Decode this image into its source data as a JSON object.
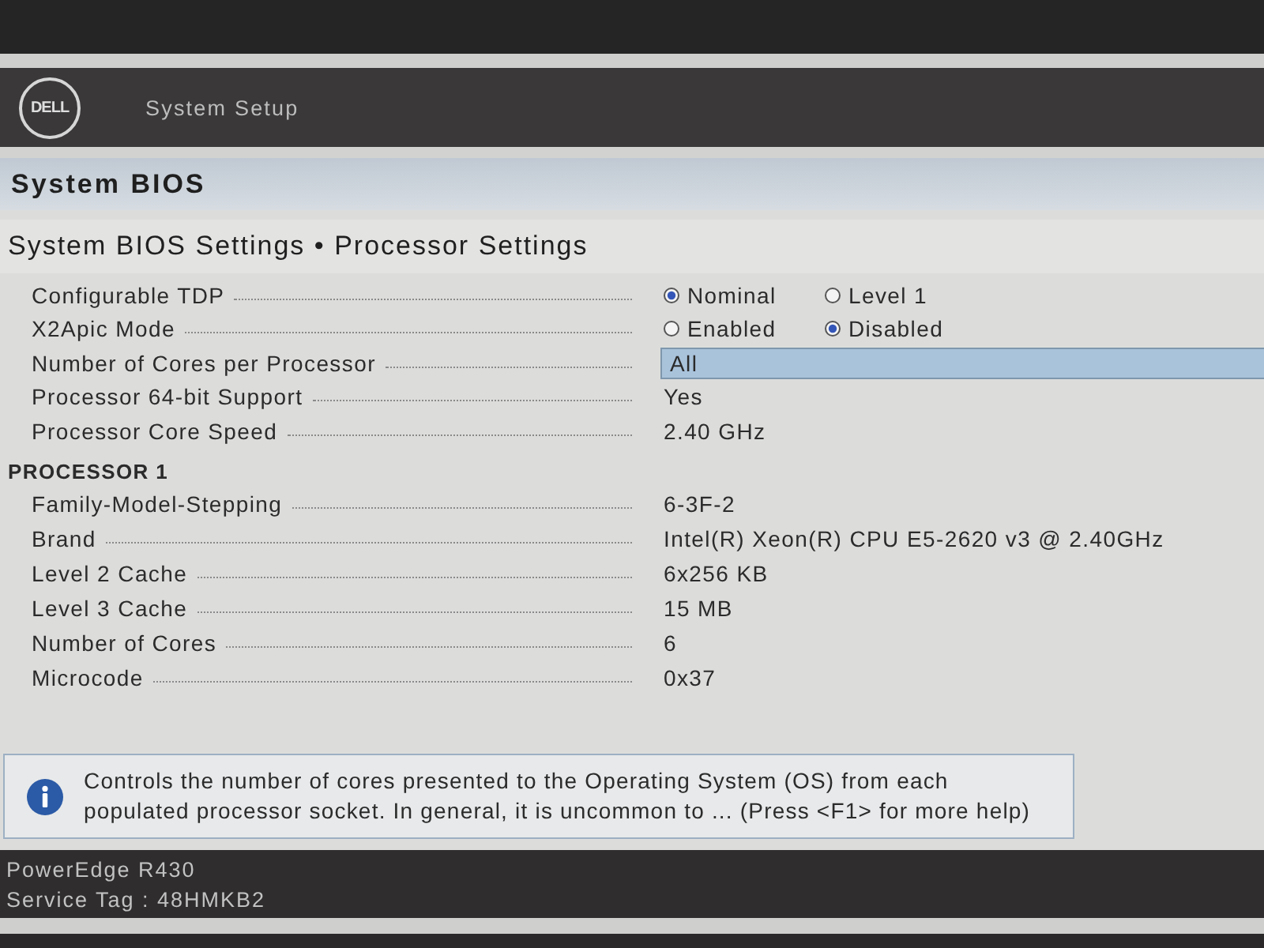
{
  "header": {
    "logo": "DELL",
    "title": "System Setup"
  },
  "section_bar": {
    "title": "System BIOS"
  },
  "page_title": "System BIOS Settings • Processor Settings",
  "settings": [
    {
      "kind": "radio",
      "label": "Configurable TDP",
      "selected": false,
      "options": [
        {
          "label": "Nominal",
          "selected": true
        },
        {
          "label": "Level 1",
          "selected": false
        }
      ]
    },
    {
      "kind": "radio",
      "label": "X2Apic Mode",
      "selected": false,
      "options": [
        {
          "label": "Enabled",
          "selected": false
        },
        {
          "label": "Disabled",
          "selected": true
        }
      ]
    },
    {
      "kind": "dropdown",
      "label": "Number of Cores per Processor",
      "selected": true,
      "value": "All"
    },
    {
      "kind": "text",
      "label": "Processor 64-bit Support",
      "selected": false,
      "value": "Yes"
    },
    {
      "kind": "text",
      "label": "Processor Core Speed",
      "selected": false,
      "value": "2.40 GHz"
    }
  ],
  "processor": {
    "heading": "PROCESSOR 1",
    "rows": [
      {
        "label": "Family-Model-Stepping",
        "value": "6-3F-2"
      },
      {
        "label": "Brand",
        "value": "Intel(R) Xeon(R) CPU E5-2620 v3 @ 2.40GHz"
      },
      {
        "label": "Level 2 Cache",
        "value": "6x256 KB"
      },
      {
        "label": "Level 3 Cache",
        "value": "15 MB"
      },
      {
        "label": "Number of Cores",
        "value": "6"
      },
      {
        "label": "Microcode",
        "value": "0x37"
      }
    ]
  },
  "help": {
    "text": "Controls the number of cores presented to the Operating System (OS) from each populated processor socket. In general, it is uncommon to ... (Press <F1> for more help)"
  },
  "footer": {
    "model": "PowerEdge R430",
    "service_tag": "Service Tag : 48HMKB2"
  }
}
